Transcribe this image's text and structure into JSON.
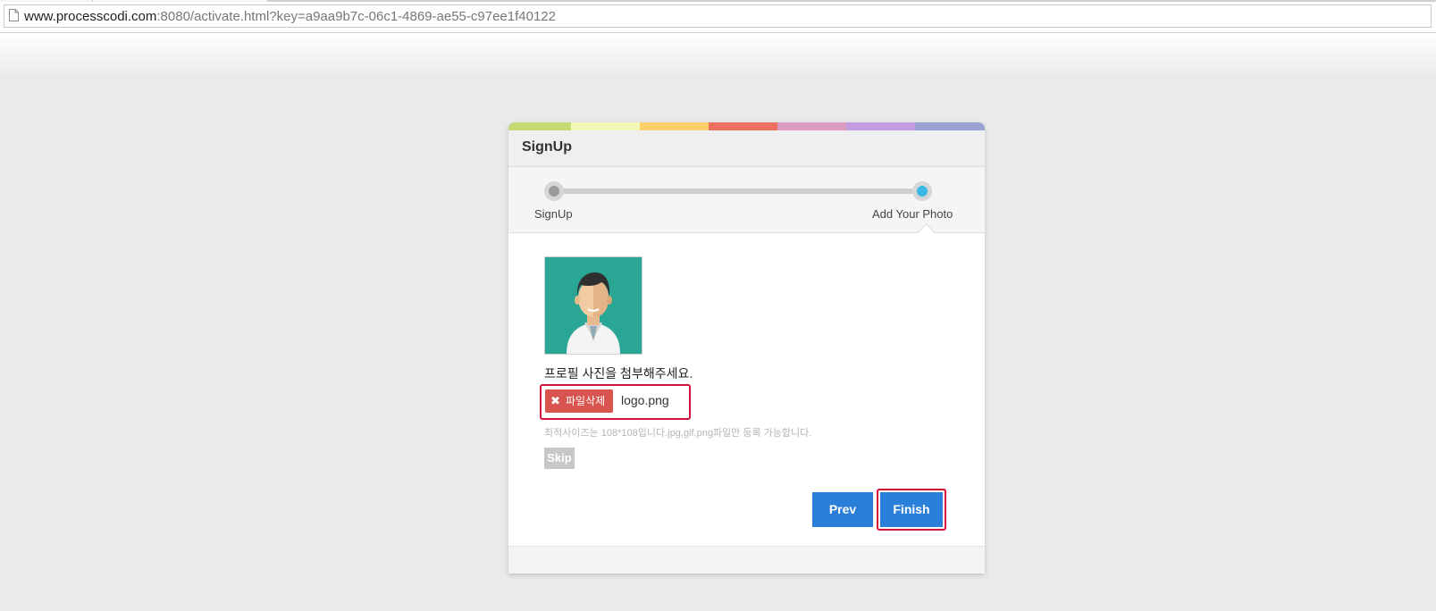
{
  "browser": {
    "url_host": "www.processcodi.com",
    "url_rest": ":8080/activate.html?key=a9aa9b7c-06c1-4869-ae55-c97ee1f40122"
  },
  "colors": {
    "stripe": [
      "#c2db72",
      "#f3f6b4",
      "#fdd06c",
      "#ee715f",
      "#dc9bbf",
      "#c29ddf",
      "#9ba1d2"
    ],
    "primary_button": "#2a7fd8",
    "delete_button": "#d9534f",
    "highlight_border": "#d2113a",
    "avatar_bg": "#2aa694",
    "step_active": "#3ab8e5",
    "step_inactive": "#9a9a9a"
  },
  "dialog": {
    "title": "SignUp",
    "steps": [
      {
        "label": "SignUp",
        "state": "done"
      },
      {
        "label": "Add Your Photo",
        "state": "active"
      }
    ],
    "avatar_icon": "user-avatar-icon",
    "prompt": "프로필 사진을 첨부해주세요.",
    "file": {
      "delete_label": "파일삭제",
      "delete_icon": "close-x-icon",
      "filename": "logo.png"
    },
    "hint": "최적사이즈는 108*108입니다.jpg,gif,png파일만 등록 가능합니다.",
    "skip_label": "Skip",
    "prev_label": "Prev",
    "finish_label": "Finish"
  }
}
